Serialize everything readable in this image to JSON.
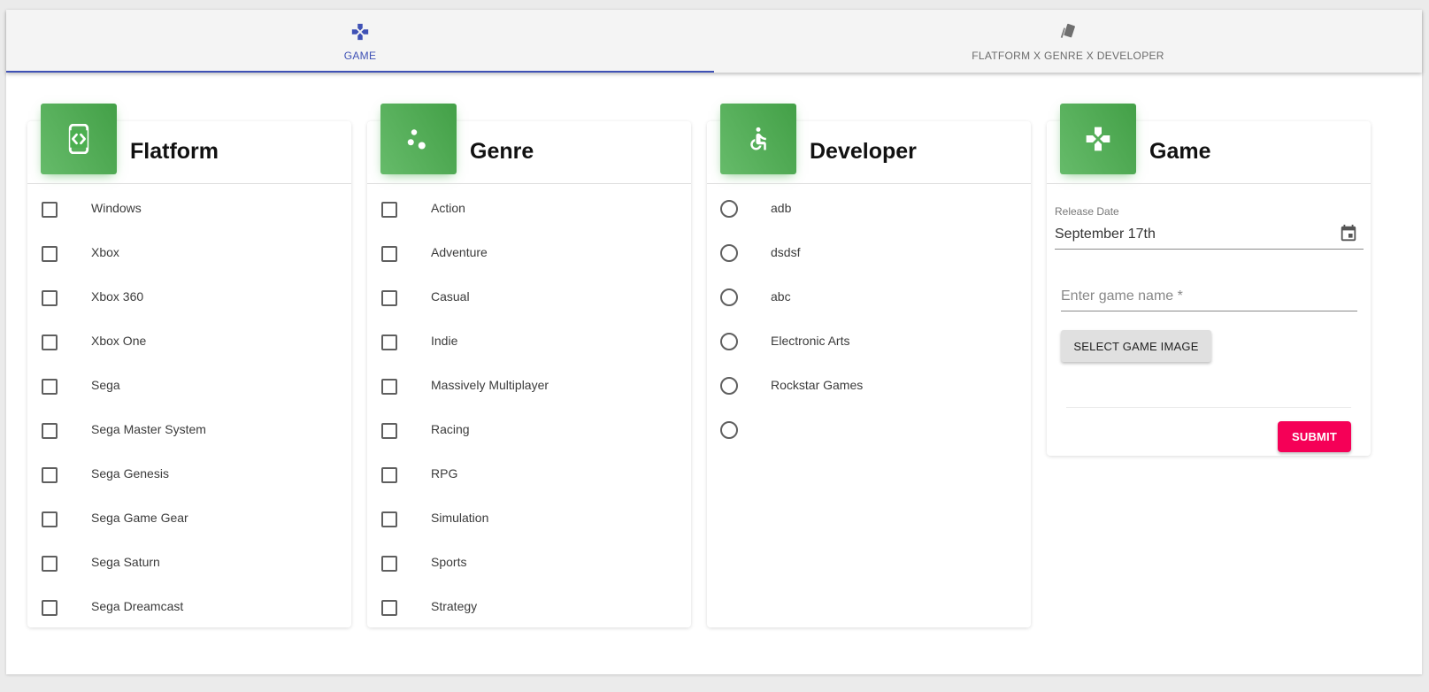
{
  "tabs": [
    {
      "label": "GAME",
      "icon": "gamepad-icon",
      "active": true
    },
    {
      "label": "FLATFORM X GENRE X DEVELOPER",
      "icon": "cards-icon",
      "active": false
    }
  ],
  "colors": {
    "accent": "#3f51b5",
    "card_icon_green": "#4caf50",
    "submit": "#f50057"
  },
  "platform_card": {
    "title": "Flatform",
    "icon": "platform-code-icon",
    "items": [
      "Windows",
      "Xbox",
      "Xbox 360",
      "Xbox One",
      "Sega",
      "Sega Master System",
      "Sega Genesis",
      "Sega Game Gear",
      "Sega Saturn",
      "Sega Dreamcast"
    ]
  },
  "genre_card": {
    "title": "Genre",
    "icon": "bubbles-icon",
    "items": [
      "Action",
      "Adventure",
      "Casual",
      "Indie",
      "Massively Multiplayer",
      "Racing",
      "RPG",
      "Simulation",
      "Sports",
      "Strategy"
    ]
  },
  "developer_card": {
    "title": "Developer",
    "icon": "accessibility-icon",
    "items": [
      "adb",
      "dsdsf",
      "abc",
      "Electronic Arts",
      "Rockstar Games",
      ""
    ]
  },
  "game_card": {
    "title": "Game",
    "icon": "gamepad-icon",
    "release_date_label": "Release Date",
    "release_date_value": "September 17th",
    "name_placeholder": "Enter game name *",
    "select_image_label": "SELECT GAME IMAGE",
    "submit_label": "SUBMIT"
  }
}
